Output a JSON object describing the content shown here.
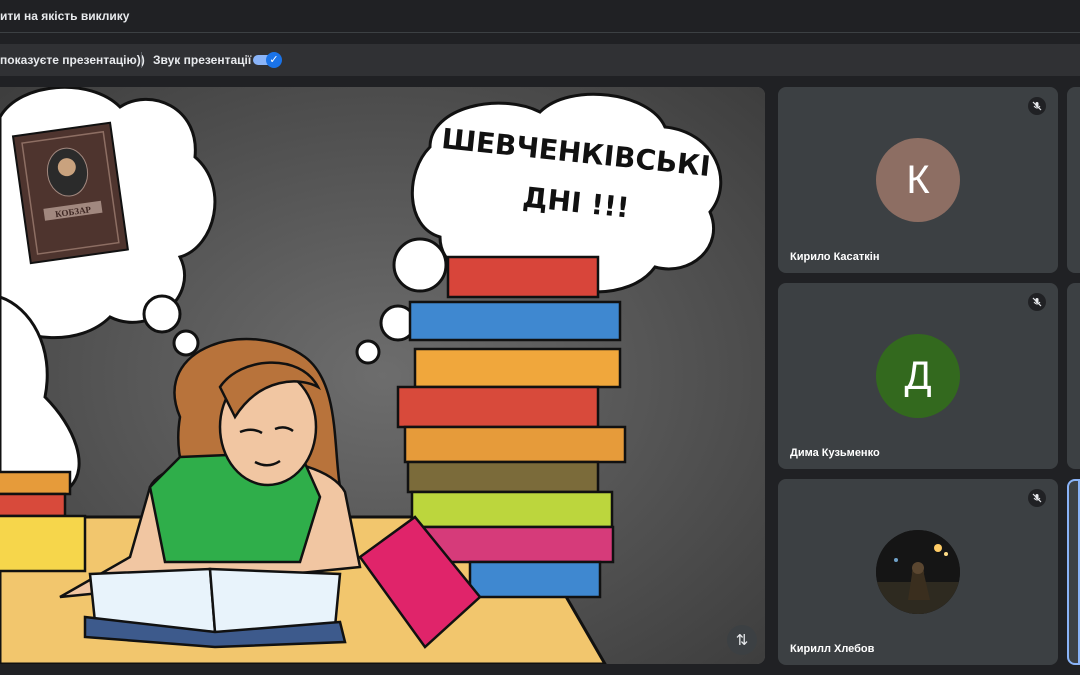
{
  "window": {
    "title": "ити на якість виклику"
  },
  "presentation_bar": {
    "message": "показуєте презентацію))",
    "audio_label": "Звук презентації",
    "audio_enabled": true
  },
  "slide": {
    "headline_line1": "ШЕВЧЕНКІВСЬКІ",
    "headline_line2": "ДНІ !!!",
    "book_cover_text": "КОБЗАР"
  },
  "participants": [
    {
      "name": "Кирило Касаткін",
      "initial": "К",
      "avatar_color": "#8d6e63",
      "muted": true,
      "mute_icon": "mic-off-icon"
    },
    {
      "name": "Дима Кузьменко",
      "initial": "Д",
      "avatar_color": "#33691e",
      "muted": true,
      "mute_icon": "mic-off-icon"
    },
    {
      "name": "Кирилл Хлебов",
      "initial": "",
      "avatar_color": "#1b1b1b",
      "muted": true,
      "mute_icon": "mic-off-icon",
      "has_photo": true
    }
  ],
  "controls": {
    "swap_icon": "swap-vertical-icon"
  },
  "colors": {
    "accent": "#8ab4f8",
    "toggle_on": "#1a73e8",
    "tile_bg": "#3c4043",
    "page_bg": "#202124"
  }
}
